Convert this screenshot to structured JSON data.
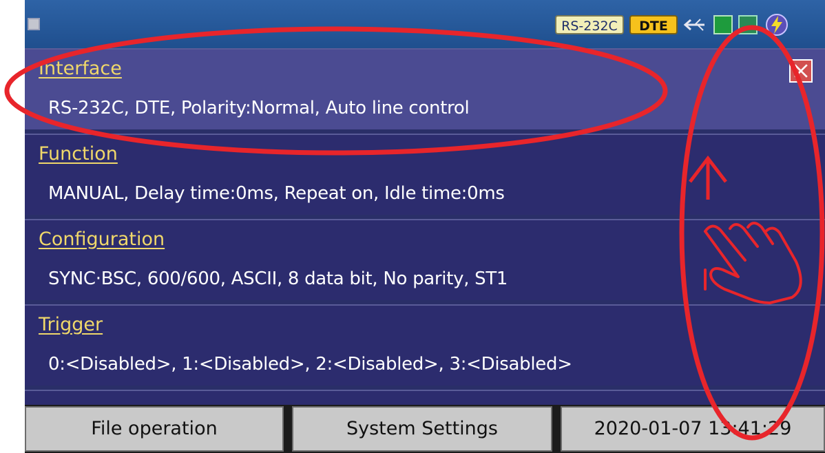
{
  "status_bar": {
    "port_badge": "RS-232C",
    "mode_badge": "DTE"
  },
  "sections": [
    {
      "title": "Interface",
      "text": "RS-232C, DTE, Polarity:Normal, Auto line control"
    },
    {
      "title": "Function",
      "text": "MANUAL, Delay time:0ms, Repeat on, Idle time:0ms"
    },
    {
      "title": "Configuration",
      "text": "SYNC·BSC, 600/600, ASCII, 8 data bit, No parity, ST1"
    },
    {
      "title": "Trigger",
      "text": "0:<Disabled>, 1:<Disabled>, 2:<Disabled>, 3:<Disabled>"
    }
  ],
  "bottom_bar": {
    "file_button": "File operation",
    "system_button": "System Settings",
    "clock": "2020-01-07 13:41:29"
  },
  "colors": {
    "screen_bg": "#2a2f68",
    "selected_row": "#4b4b92",
    "title_text": "#f0d86a",
    "annotation": "#e8252b"
  },
  "icons": [
    "menu-square-icon",
    "usb-icon",
    "status-green-icon",
    "power-icon",
    "close-icon",
    "arrow-up-icon",
    "swipe-hand-icon"
  ]
}
